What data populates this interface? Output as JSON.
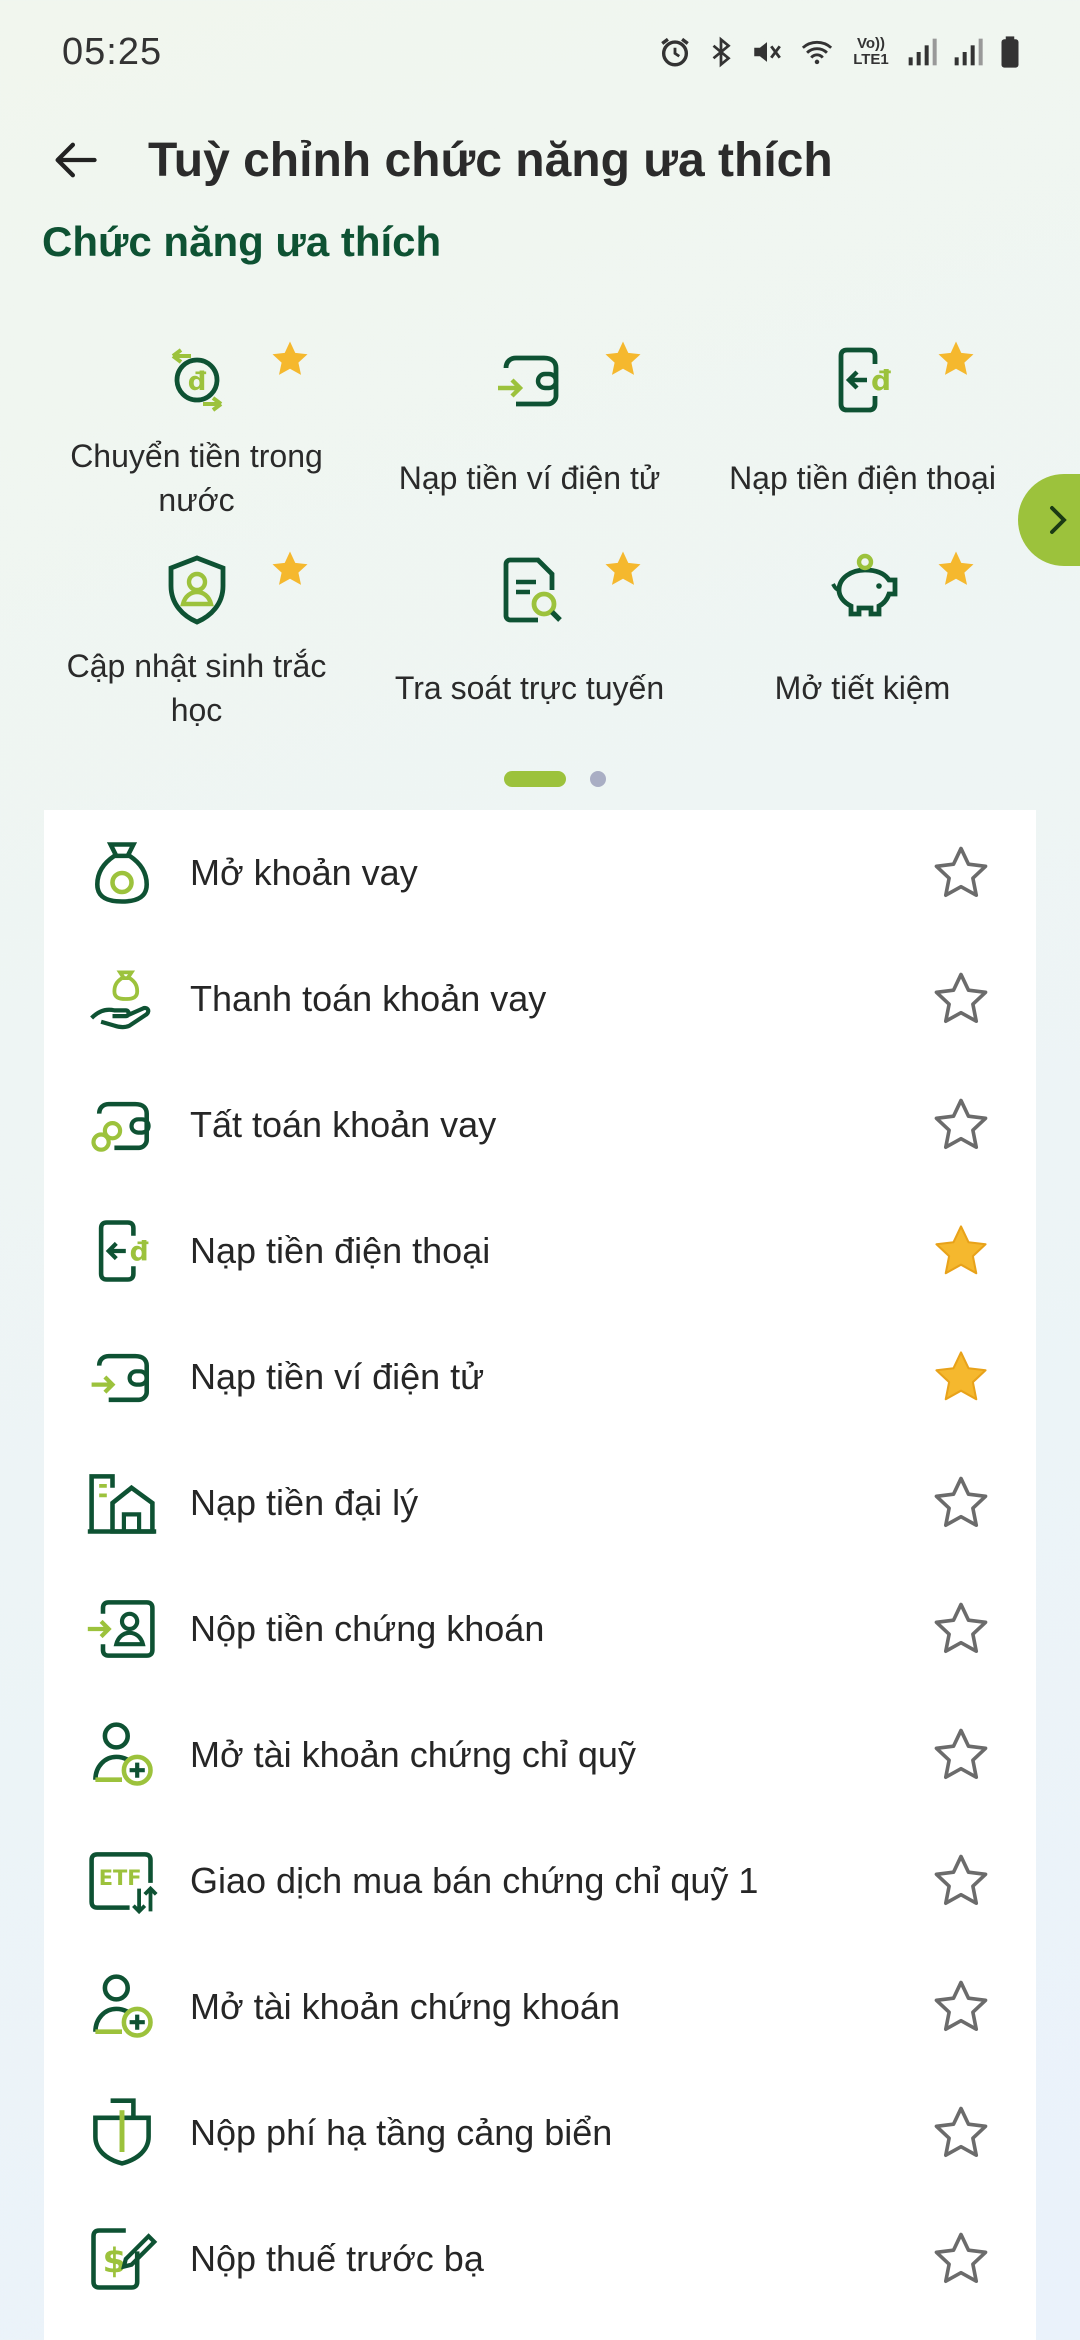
{
  "status_bar": {
    "time": "05:25",
    "icons": [
      "alarm-icon",
      "bluetooth-icon",
      "mute-icon",
      "wifi-icon",
      "volte-icon",
      "signal-icon",
      "signal-icon",
      "battery-icon"
    ],
    "volte_text": "Vo)) LTE1"
  },
  "header": {
    "title": "Tuỳ chỉnh chức năng ưa thích",
    "back_icon": "arrow-left-icon"
  },
  "favorites": {
    "section_title": "Chức năng ưa thích",
    "items": [
      {
        "label": "Chuyển tiền trong nước",
        "icon": "transfer-icon"
      },
      {
        "label": "Nạp tiền ví điện tử",
        "icon": "wallet-icon"
      },
      {
        "label": "Nạp tiền điện thoại",
        "icon": "phone-topup-icon"
      },
      {
        "label": "Cập nhật sinh trắc học",
        "icon": "biometric-shield-icon"
      },
      {
        "label": "Tra soát trực tuyến",
        "icon": "document-search-icon"
      },
      {
        "label": "Mở tiết kiệm",
        "icon": "piggy-bank-icon"
      }
    ],
    "pagination": {
      "current": 1,
      "total": 2
    }
  },
  "all_functions": [
    {
      "label": "Mở khoản vay",
      "icon": "money-bag-icon",
      "favorite": false
    },
    {
      "label": "Thanh toán khoản vay",
      "icon": "hand-money-icon",
      "favorite": false
    },
    {
      "label": "Tất toán khoản vay",
      "icon": "loan-settle-icon",
      "favorite": false
    },
    {
      "label": "Nạp tiền điện thoại",
      "icon": "phone-topup-icon",
      "favorite": true
    },
    {
      "label": "Nạp tiền ví điện tử",
      "icon": "wallet-icon",
      "favorite": true
    },
    {
      "label": "Nạp tiền đại lý",
      "icon": "agent-store-icon",
      "favorite": false
    },
    {
      "label": "Nộp tiền chứng khoán",
      "icon": "securities-deposit-icon",
      "favorite": false
    },
    {
      "label": "Mở tài khoản chứng chỉ quỹ",
      "icon": "add-user-icon",
      "favorite": false
    },
    {
      "label": "Giao dịch mua bán chứng chỉ quỹ 1",
      "icon": "etf-icon",
      "favorite": false
    },
    {
      "label": "Mở tài khoản chứng khoán",
      "icon": "add-user-icon",
      "favorite": false
    },
    {
      "label": "Nộp phí hạ tầng cảng biển",
      "icon": "ship-icon",
      "favorite": false
    },
    {
      "label": "Nộp thuế trước bạ",
      "icon": "tax-icon",
      "favorite": false
    }
  ],
  "colors": {
    "primary_dark": "#0e5233",
    "accent": "#9cc23c",
    "star_filled": "#f5b82e"
  }
}
